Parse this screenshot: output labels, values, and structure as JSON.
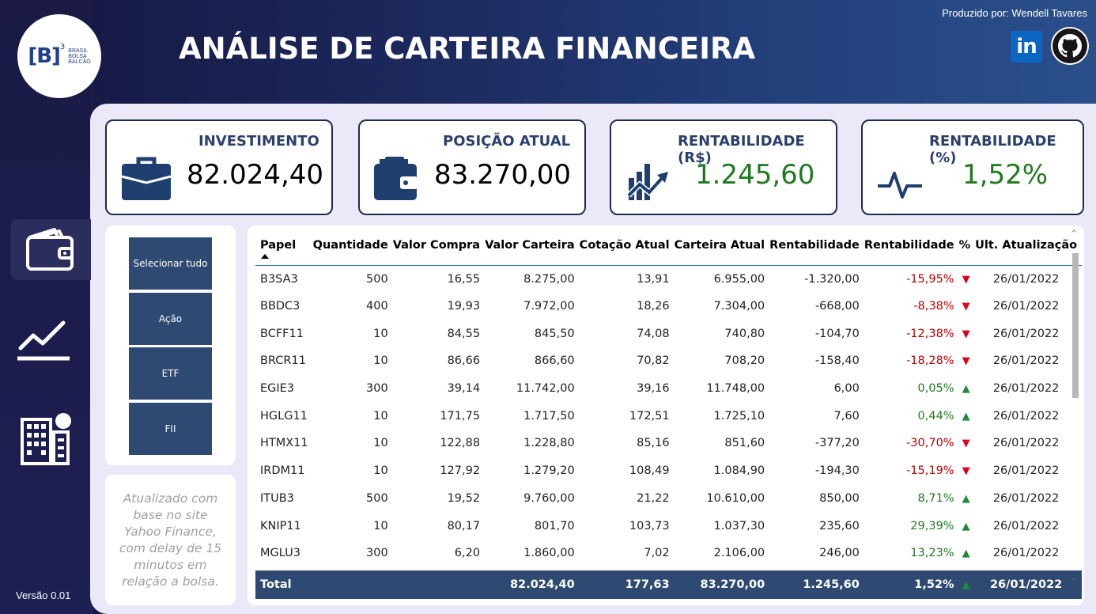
{
  "header": {
    "title": "ANÁLISE DE CARTEIRA FINANCEIRA",
    "producer": "Produzido por: Wendell Tavares",
    "logo_mark": "[B]",
    "logo_sup": "3",
    "logo_lines": [
      "BRASIL",
      "BOLSA",
      "BALCÃO"
    ],
    "linkedin_label": "in"
  },
  "sidebar": {
    "items": [
      {
        "icon": "wallet-icon",
        "active": true
      },
      {
        "icon": "line-chart-icon",
        "active": false
      },
      {
        "icon": "building-icon",
        "active": false
      }
    ],
    "version": "Versão 0.01"
  },
  "kpis": {
    "investimento": {
      "title": "INVESTIMENTO",
      "value": "82.024,40",
      "icon": "briefcase-icon"
    },
    "posicao": {
      "title": "POSIÇÃO ATUAL",
      "value": "83.270,00",
      "icon": "wallet-icon"
    },
    "rent_rs": {
      "title": "RENTABILIDADE (R$)",
      "value": "1.245,60",
      "icon": "growth-chart-icon"
    },
    "rent_pct": {
      "title": "RENTABILIDADE (%)",
      "value": "1,52%",
      "icon": "pulse-icon"
    }
  },
  "filters": {
    "buttons": [
      "Selecionar tudo",
      "Ação",
      "ETF",
      "FII"
    ]
  },
  "note": "Atualizado com base no site Yahoo Finance, com delay de 15 minutos em relação a bolsa.",
  "table": {
    "headers": [
      "Papel",
      "Quantidade",
      "Valor Compra",
      "Valor Carteira",
      "Cotação Atual",
      "Carteira Atual",
      "Rentabilidade",
      "Rentabilidade",
      "%",
      "Ult. Atualização"
    ],
    "rows": [
      {
        "papel": "B3SA3",
        "qtd": "500",
        "vcompra": "16,55",
        "vcarteira": "8.275,00",
        "cot": "13,91",
        "catual": "6.955,00",
        "rent": "-1.320,00",
        "pct": "-15,95%",
        "dir": "down",
        "data": "26/01/2022"
      },
      {
        "papel": "BBDC3",
        "qtd": "400",
        "vcompra": "19,93",
        "vcarteira": "7.972,00",
        "cot": "18,26",
        "catual": "7.304,00",
        "rent": "-668,00",
        "pct": "-8,38%",
        "dir": "down",
        "data": "26/01/2022"
      },
      {
        "papel": "BCFF11",
        "qtd": "10",
        "vcompra": "84,55",
        "vcarteira": "845,50",
        "cot": "74,08",
        "catual": "740,80",
        "rent": "-104,70",
        "pct": "-12,38%",
        "dir": "down",
        "data": "26/01/2022"
      },
      {
        "papel": "BRCR11",
        "qtd": "10",
        "vcompra": "86,66",
        "vcarteira": "866,60",
        "cot": "70,82",
        "catual": "708,20",
        "rent": "-158,40",
        "pct": "-18,28%",
        "dir": "down",
        "data": "26/01/2022"
      },
      {
        "papel": "EGIE3",
        "qtd": "300",
        "vcompra": "39,14",
        "vcarteira": "11.742,00",
        "cot": "39,16",
        "catual": "11.748,00",
        "rent": "6,00",
        "pct": "0,05%",
        "dir": "up",
        "data": "26/01/2022"
      },
      {
        "papel": "HGLG11",
        "qtd": "10",
        "vcompra": "171,75",
        "vcarteira": "1.717,50",
        "cot": "172,51",
        "catual": "1.725,10",
        "rent": "7,60",
        "pct": "0,44%",
        "dir": "up",
        "data": "26/01/2022"
      },
      {
        "papel": "HTMX11",
        "qtd": "10",
        "vcompra": "122,88",
        "vcarteira": "1.228,80",
        "cot": "85,16",
        "catual": "851,60",
        "rent": "-377,20",
        "pct": "-30,70%",
        "dir": "down",
        "data": "26/01/2022"
      },
      {
        "papel": "IRDM11",
        "qtd": "10",
        "vcompra": "127,92",
        "vcarteira": "1.279,20",
        "cot": "108,49",
        "catual": "1.084,90",
        "rent": "-194,30",
        "pct": "-15,19%",
        "dir": "down",
        "data": "26/01/2022"
      },
      {
        "papel": "ITUB3",
        "qtd": "500",
        "vcompra": "19,52",
        "vcarteira": "9.760,00",
        "cot": "21,22",
        "catual": "10.610,00",
        "rent": "850,00",
        "pct": "8,71%",
        "dir": "up",
        "data": "26/01/2022"
      },
      {
        "papel": "KNIP11",
        "qtd": "10",
        "vcompra": "80,17",
        "vcarteira": "801,70",
        "cot": "103,73",
        "catual": "1.037,30",
        "rent": "235,60",
        "pct": "29,39%",
        "dir": "up",
        "data": "26/01/2022"
      },
      {
        "papel": "MGLU3",
        "qtd": "300",
        "vcompra": "6,20",
        "vcarteira": "1.860,00",
        "cot": "7,02",
        "catual": "2.106,00",
        "rent": "246,00",
        "pct": "13,23%",
        "dir": "up",
        "data": "26/01/2022"
      }
    ],
    "total": {
      "label": "Total",
      "vcarteira": "82.024,40",
      "cot": "177,63",
      "catual": "83.270,00",
      "rent": "1.245,60",
      "pct": "1,52%",
      "dir": "up",
      "data": "26/01/2022"
    },
    "arrows": {
      "up": "▲",
      "down": "▼"
    }
  },
  "colors": {
    "positive": "#1f7a1f",
    "negative": "#c00000",
    "filter_bg": "#2e4a72",
    "header_bg": "#1b1d4a"
  }
}
